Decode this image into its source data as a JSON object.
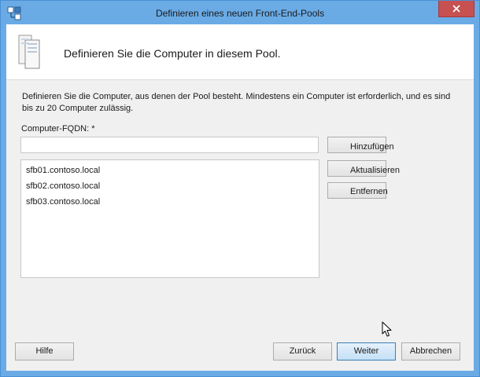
{
  "window": {
    "title": "Definieren eines neuen Front-End-Pools",
    "close_symbol": "✕"
  },
  "header": {
    "title": "Definieren Sie die Computer in diesem Pool.",
    "icon": "server-icon"
  },
  "body": {
    "description": "Definieren Sie die Computer, aus denen der Pool besteht. Mindestens ein Computer ist erforderlich, und es sind bis zu 20 Computer zulässig.",
    "fqdn_label": "Computer-FQDN: *",
    "fqdn_value": "",
    "computers": [
      "sfb01.contoso.local",
      "sfb02.contoso.local",
      "sfb03.contoso.local"
    ]
  },
  "side_buttons": {
    "add": "Hinzufügen",
    "refresh": "Aktualisieren",
    "remove": "Entfernen"
  },
  "footer": {
    "help": "Hilfe",
    "back": "Zurück",
    "next": "Weiter",
    "cancel": "Abbrechen"
  },
  "colors": {
    "titlebar": "#6aabe6",
    "close_button": "#c75050",
    "primary_button": "#c4e0f7"
  }
}
